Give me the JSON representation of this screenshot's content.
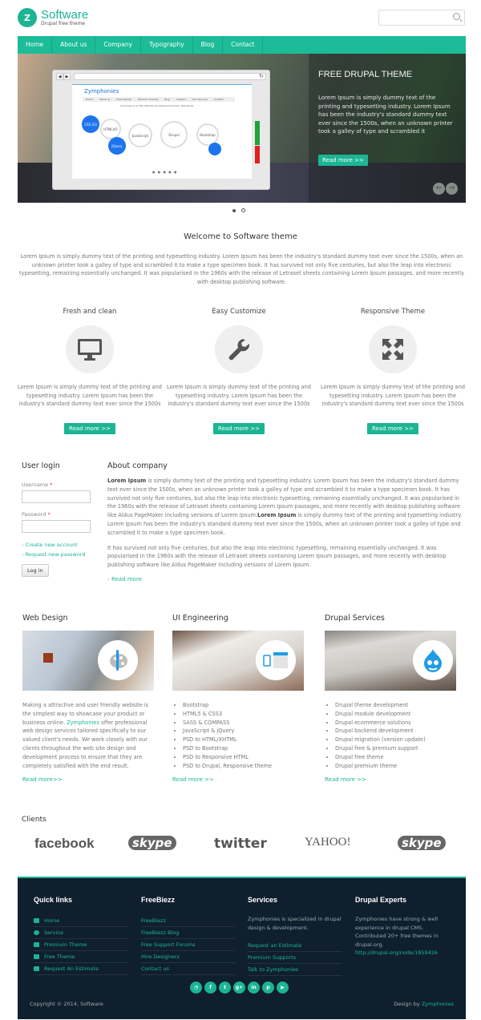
{
  "header": {
    "site_name": "Software",
    "slogan": "Drupal free theme",
    "search_placeholder": ""
  },
  "nav": [
    "Home",
    "About us",
    "Company",
    "Typography",
    "Blog",
    "Contact"
  ],
  "slider": {
    "title": "FREE DRUPAL THEME",
    "text": "Lorem Ipsum is simply dummy text of the printing and typesetting industry. Lorem Ipsum has been the industry's standard dummy text ever since the 1500s, when an unknown printer took a galley of type and scrambled it",
    "button": "Read more >>",
    "prev_icon": "arrow-left-icon",
    "next_icon": "arrow-right-icon",
    "screenshot": {
      "logo": "Zymphonies",
      "nav": [
        "Home",
        "About us",
        "Free themes",
        "Premium themes",
        "Blog",
        "Support",
        "Our Services",
        "Contact"
      ],
      "tagline": "eCommerce & CMS Website Development Drupal, Wordpress",
      "circles": [
        "CSS 2/3",
        "HTML4/5",
        "jQuery",
        "JavaScript",
        "Drupal",
        "Bootstrap"
      ]
    },
    "pages": 2,
    "active_page": 1
  },
  "welcome": {
    "title": "Welcome to Software theme",
    "text": "Lorem Ipsum is simply dummy text of the printing and typesetting industry. Lorem Ipsum has been the industry's standard dummy text ever since the 1500s, when an unknown printer took a galley of type and scrambled it to make a type specimen book. It has survived not only five centuries, but also the leap into electronic typesetting, remaining essentially unchanged. It was popularised in the 1960s with the release of Letraset sheets containing Lorem Ipsum passages, and more recently with desktop publishing software."
  },
  "features": [
    {
      "title": "Fresh and clean",
      "icon": "monitor-icon",
      "text": "Lorem Ipsum is simply dummy text of the printing and typesetting industry. Lorem Ipsum has been the industry's standard dummy text ever since the 1500s",
      "button": "Read more >>"
    },
    {
      "title": "Easy Customize",
      "icon": "wrench-icon",
      "text": "Lorem Ipsum is simply dummy text of the printing and typesetting industry. Lorem Ipsum has been the industry's standard dummy text ever since the 1500s",
      "button": "Read more >>"
    },
    {
      "title": "Responsive Theme",
      "icon": "expand-icon",
      "text": "Lorem Ipsum is simply dummy text of the printing and typesetting industry. Lorem Ipsum has been the industry's standard dummy text ever since the 1500s",
      "button": "Read more >>"
    }
  ],
  "login": {
    "title": "User login",
    "username_label": "Username",
    "password_label": "Password",
    "required_mark": "*",
    "username_value": "",
    "password_value": "",
    "create_account": "Create new account",
    "request_password": "Request new password",
    "submit": "Log in"
  },
  "about": {
    "title": "About company",
    "p1_bold1": "Lorem Ipsum",
    "p1_a": " is simply dummy text of the printing and typesetting industry. Lorem Ipsum has been the industry's standard dummy text ever since the 1500s, when an unknown printer took a galley of type and scrambled it to make a type specimen book. It has survived not only five centuries, but also the leap into electronic typesetting, remaining essentially unchanged. It was popularised in the 1960s with the release of Letraset sheets containing Lorem Ipsum passages, and more recently with desktop publishing software like Aldus PageMaker including versions of Lorem Ipsum.",
    "p1_bold2": "Lorem Ipsum",
    "p1_b": " is simply dummy text of the printing and typesetting industry. Lorem Ipsum has been the industry's standard dummy text ever since the 1500s, when an unknown printer took a galley of type and scrambled it to make a type specimen book.",
    "p2": "It has survived not only five centuries, but also the leap into electronic typesetting, remaining essentially unchanged. It was popularised in the 1960s with the release of Letraset sheets containing Lorem Ipsum passages, and more recently with desktop publishing software like Aldus PageMaker including versions of Lorem Ipsum.",
    "read_more": "Read more"
  },
  "services": [
    {
      "title": "Web Design",
      "badge_icon": "paint-palette-icon",
      "text_a": "Making a attractive and user friendly website is the simplest way to showcase your product or business online. ",
      "link": "Zymphonies",
      "text_b": " offer professional web design services tailored specifically to our valued client's needs. We work closely with our clients throughout the web site design and development process to ensure that they are completely satisfied with the end result.",
      "read_more": "Read more>>"
    },
    {
      "title": "UI Engineering",
      "badge_icon": "responsive-devices-icon",
      "items": [
        "Bootstrap",
        "HTML5 & CSS3",
        "SASS & COMPASS",
        "JavaScript & jQuery",
        "PSD to HTML/XHTML",
        "PSD to Bootstrap",
        "PSD to Responsive HTML",
        "PSD to Drupal, Responsive theme"
      ],
      "read_more": "Read more >>"
    },
    {
      "title": "Drupal Services",
      "badge_icon": "drupal-drop-icon",
      "items": [
        "Drupal theme development",
        "Drupal module development",
        "Drupal ecommerce solutions",
        "Drupal backend development",
        "Drupal migration (version update)",
        "Drupal free & premium support",
        "Drupal free theme",
        "Drupal premium theme"
      ],
      "read_more": "Read more >>"
    }
  ],
  "clients": {
    "title": "Clients",
    "logos": [
      "facebook",
      "skype",
      "twitter",
      "YAHOO!",
      "skype"
    ]
  },
  "footer": {
    "quick_links": {
      "title": "Quick links",
      "items": [
        {
          "label": "Home",
          "icon": "home-icon"
        },
        {
          "label": "Service",
          "icon": "gear-icon"
        },
        {
          "label": "Premium Theme",
          "icon": "laptop-icon"
        },
        {
          "label": "Free Theme",
          "icon": "image-icon"
        },
        {
          "label": "Request An Estimate",
          "icon": "list-icon"
        }
      ]
    },
    "freebiezz": {
      "title": "FreeBiezz",
      "items": [
        "FreeBiezz",
        "FreeBiezz Blog",
        "Free Support Forums",
        "Hire Designers",
        "Contact us"
      ]
    },
    "services": {
      "title": "Services",
      "text": "Zymphonies is specialized in drupal design & development.",
      "items": [
        "Request an Estimate",
        "Premium Supports",
        "Talk to Zymphonies"
      ]
    },
    "experts": {
      "title": "Drupal Experts",
      "text": "Zymphonies have strong & well experience in drupal CMS. Contributed 20+ free themes in drupal.org.",
      "link": "http://drupal.org/node/1859426"
    },
    "social": [
      {
        "name": "rss",
        "glyph": "◔"
      },
      {
        "name": "facebook",
        "glyph": "f"
      },
      {
        "name": "twitter",
        "glyph": "t"
      },
      {
        "name": "google-plus",
        "glyph": "g+"
      },
      {
        "name": "linkedin",
        "glyph": "in"
      },
      {
        "name": "pinterest",
        "glyph": "p"
      },
      {
        "name": "youtube",
        "glyph": "▶"
      }
    ],
    "copyright": "Copyright © 2014, Software",
    "design_by_label": "Design by ",
    "design_by_link": "Zymphonies"
  },
  "colors": {
    "accent": "#1cb594",
    "nav": "#1cbc98",
    "footer_bg": "#0f1f2e"
  }
}
